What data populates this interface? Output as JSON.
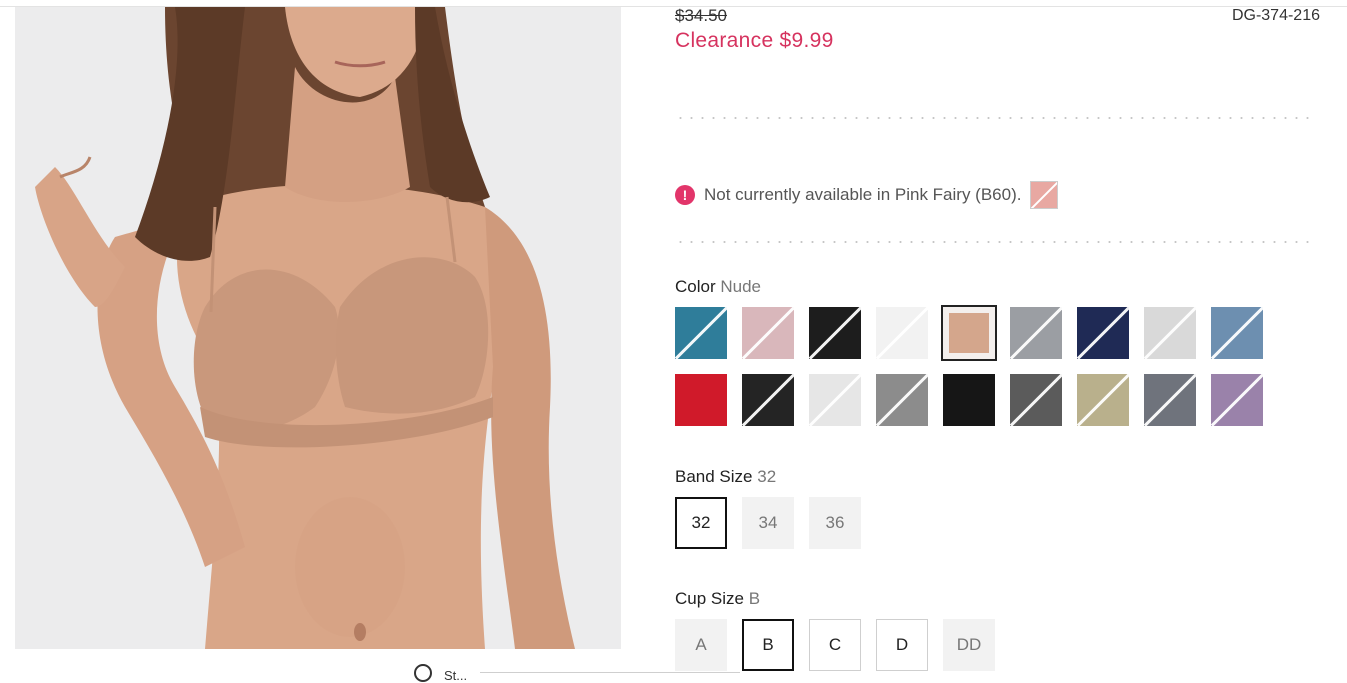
{
  "product": {
    "original_price": "$34.50",
    "clearance_price": "Clearance $9.99",
    "sku": "DG-374-216"
  },
  "notice": {
    "text": "Not currently available in Pink Fairy (B60).",
    "swatch_color": "#e8a8a2"
  },
  "color": {
    "label": "Color",
    "selected": "Nude",
    "swatches": [
      {
        "name": "teal",
        "color": "#2f7d9a",
        "unavailable": true
      },
      {
        "name": "blush",
        "color": "#d9b7bb",
        "unavailable": true
      },
      {
        "name": "black",
        "color": "#1d1d1d",
        "unavailable": true
      },
      {
        "name": "white-black-dot",
        "color": "#f2f2f2",
        "unavailable": true
      },
      {
        "name": "nude",
        "color": "#d4a68c",
        "unavailable": false,
        "selected": true
      },
      {
        "name": "gray-metallic",
        "color": "#9b9ea3",
        "unavailable": true
      },
      {
        "name": "navy-dot",
        "color": "#1f2a55",
        "unavailable": true
      },
      {
        "name": "light-gray",
        "color": "#d9d9d9",
        "unavailable": true
      },
      {
        "name": "dusty-blue",
        "color": "#6d8fb0",
        "unavailable": true
      },
      {
        "name": "red-dot",
        "color": "#d01a2a",
        "unavailable": false
      },
      {
        "name": "black-satin",
        "color": "#242424",
        "unavailable": true
      },
      {
        "name": "white-satin",
        "color": "#e6e6e6",
        "unavailable": true
      },
      {
        "name": "geo-print",
        "color": "#8c8c8c",
        "unavailable": true
      },
      {
        "name": "black-solid",
        "color": "#161616",
        "unavailable": false
      },
      {
        "name": "charcoal-marble",
        "color": "#5b5b5b",
        "unavailable": true
      },
      {
        "name": "sand-marble",
        "color": "#b9b08c",
        "unavailable": true
      },
      {
        "name": "slate-marble",
        "color": "#6f737c",
        "unavailable": true
      },
      {
        "name": "lavender-marble",
        "color": "#9a82aa",
        "unavailable": true
      }
    ]
  },
  "band": {
    "label": "Band Size",
    "selected": "32",
    "options": [
      {
        "label": "32",
        "state": "sel"
      },
      {
        "label": "34",
        "state": "disabled"
      },
      {
        "label": "36",
        "state": "disabled"
      }
    ]
  },
  "cup": {
    "label": "Cup Size",
    "selected": "B",
    "options": [
      {
        "label": "A",
        "state": "disabled"
      },
      {
        "label": "B",
        "state": "sel"
      },
      {
        "label": "C",
        "state": "avail"
      },
      {
        "label": "D",
        "state": "avail"
      },
      {
        "label": "DD",
        "state": "disabled"
      }
    ]
  },
  "below_photo": {
    "text": "St..."
  }
}
